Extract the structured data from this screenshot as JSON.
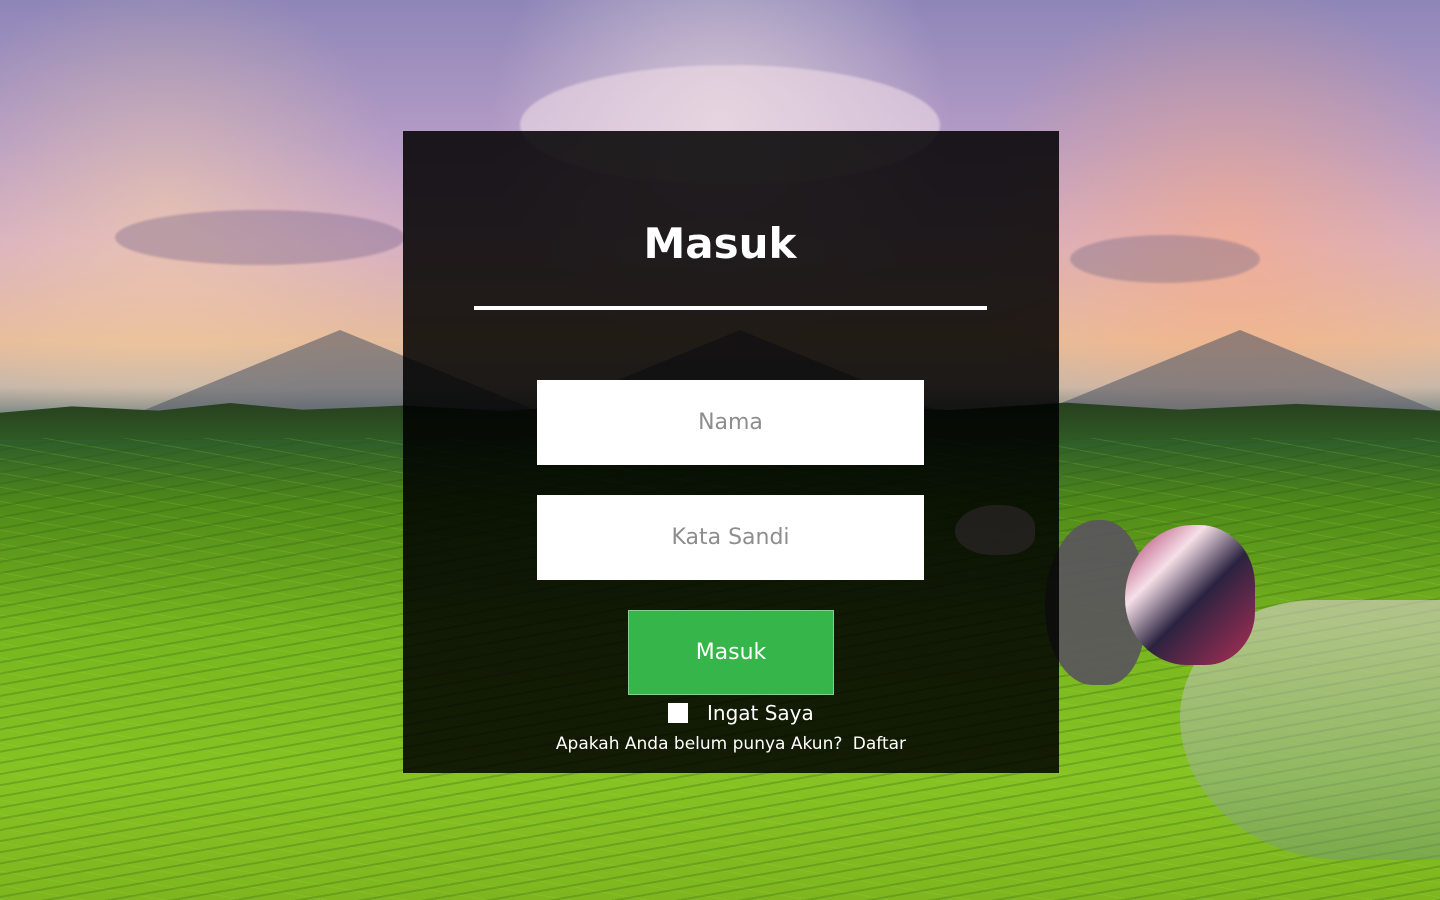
{
  "page": {
    "title": "Masuk"
  },
  "login": {
    "heading": "Masuk",
    "name_placeholder": "Nama",
    "password_placeholder": "Kata Sandi",
    "submit_label": "Masuk",
    "remember_label": "Ingat Saya",
    "signup_prompt": "Apakah Anda belum punya Akun?",
    "signup_link": "Daftar"
  },
  "colors": {
    "overlay": "#000000",
    "button": "#36b54a",
    "text": "#ffffff"
  },
  "icons": {
    "remember": "checkbox"
  }
}
